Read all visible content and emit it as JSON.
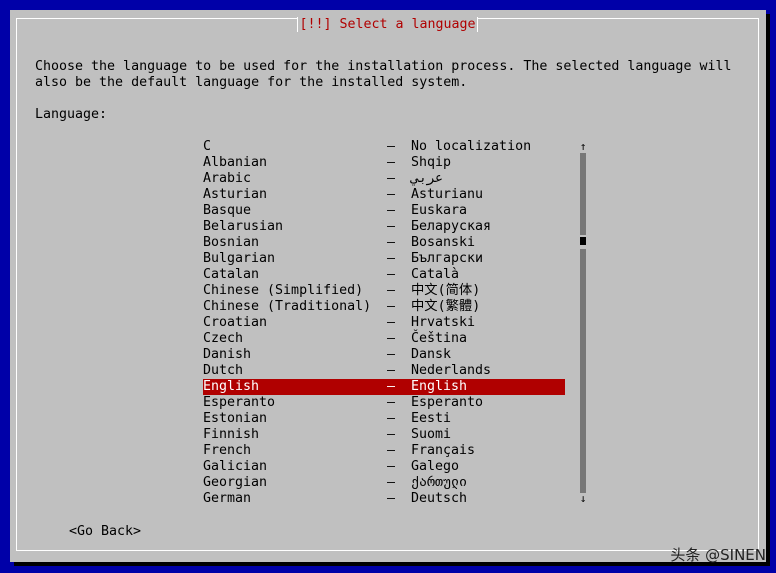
{
  "dialog": {
    "title": "[!!] Select a language",
    "description": "Choose the language to be used for the installation process. The selected language will\nalso be the default language for the installed system.",
    "language_label": "Language:",
    "go_back": "<Go Back>"
  },
  "languages": [
    {
      "name": "C",
      "native": "No localization"
    },
    {
      "name": "Albanian",
      "native": "Shqip"
    },
    {
      "name": "Arabic",
      "native": "عربي"
    },
    {
      "name": "Asturian",
      "native": "Asturianu"
    },
    {
      "name": "Basque",
      "native": "Euskara"
    },
    {
      "name": "Belarusian",
      "native": "Беларуская"
    },
    {
      "name": "Bosnian",
      "native": "Bosanski"
    },
    {
      "name": "Bulgarian",
      "native": "Български"
    },
    {
      "name": "Catalan",
      "native": "Català"
    },
    {
      "name": "Chinese (Simplified)",
      "native": "中文(简体)"
    },
    {
      "name": "Chinese (Traditional)",
      "native": "中文(繁體)"
    },
    {
      "name": "Croatian",
      "native": "Hrvatski"
    },
    {
      "name": "Czech",
      "native": "Čeština"
    },
    {
      "name": "Danish",
      "native": "Dansk"
    },
    {
      "name": "Dutch",
      "native": "Nederlands"
    },
    {
      "name": "English",
      "native": "English",
      "selected": true
    },
    {
      "name": "Esperanto",
      "native": "Esperanto"
    },
    {
      "name": "Estonian",
      "native": "Eesti"
    },
    {
      "name": "Finnish",
      "native": "Suomi"
    },
    {
      "name": "French",
      "native": "Français"
    },
    {
      "name": "Galician",
      "native": "Galego"
    },
    {
      "name": "Georgian",
      "native": "ქართული"
    },
    {
      "name": "German",
      "native": "Deutsch"
    }
  ],
  "separator": "–",
  "scrollbar": {
    "up": "↑",
    "down": "↓"
  },
  "watermark": "头条 @SINEN",
  "colors": {
    "background": "#0000a8",
    "dialog": "#c0c0c0",
    "selection": "#b00000",
    "title_text": "#b00000"
  }
}
